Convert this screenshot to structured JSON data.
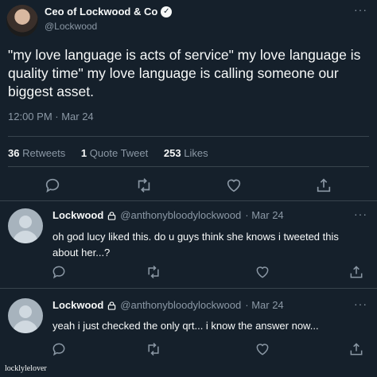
{
  "main_tweet": {
    "author_name": "Ceo of Lockwood & Co",
    "handle": "@Lockwood",
    "text": "\"my love language is acts of service\" my love language is quality time\" my love language is calling someone our biggest asset.",
    "timestamp": "12:00 PM · Mar 24",
    "stats": {
      "retweets_count": "36",
      "retweets_label": "Retweets",
      "quote_count": "1",
      "quote_label": "Quote Tweet",
      "likes_count": "253",
      "likes_label": "Likes"
    },
    "icons": [
      "reply-icon",
      "retweet-icon",
      "like-icon",
      "share-icon"
    ]
  },
  "replies": [
    {
      "author_name": "Lockwood",
      "handle": "@anthonybloodylockwood",
      "date": "· Mar 24",
      "text": "oh god lucy liked this. do u guys think she knows i tweeted this about her...?"
    },
    {
      "author_name": "Lockwood",
      "handle": "@anthonybloodylockwood",
      "date": "· Mar 24",
      "text": "yeah i just checked the only qrt... i know the answer now..."
    }
  ],
  "watermark": "locklylelover",
  "colors": {
    "background": "#15202b",
    "text": "#f7f9f9",
    "secondary": "#8b98a5",
    "divider": "#38444d"
  }
}
